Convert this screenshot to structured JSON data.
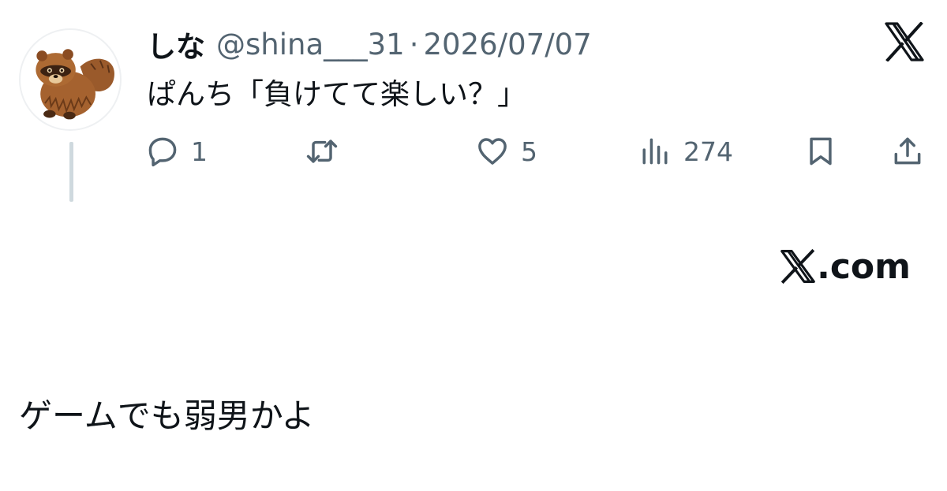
{
  "tweet": {
    "display_name": "しな",
    "handle": "@shina___31",
    "separator": "·",
    "date": "2026/07/07",
    "text": "ぱんち「負けてて楽しい？」",
    "avatar_icon": "tanuki-avatar",
    "platform_icon": "x-logo-icon"
  },
  "actions": {
    "reply": {
      "icon": "reply-icon",
      "count": "1"
    },
    "retweet": {
      "icon": "retweet-icon",
      "count": ""
    },
    "like": {
      "icon": "heart-icon",
      "count": "5"
    },
    "views": {
      "icon": "views-icon",
      "count": "274"
    },
    "bookmark": {
      "icon": "bookmark-icon"
    },
    "share": {
      "icon": "share-icon"
    }
  },
  "watermark": {
    "text": ".com",
    "icon": "x-logo-icon"
  },
  "caption": "ゲームでも弱男かよ",
  "colors": {
    "text_primary": "#0f1419",
    "text_secondary": "#536471",
    "thread_line": "#cfd9de",
    "avatar_fur": "#9a5a2b"
  }
}
